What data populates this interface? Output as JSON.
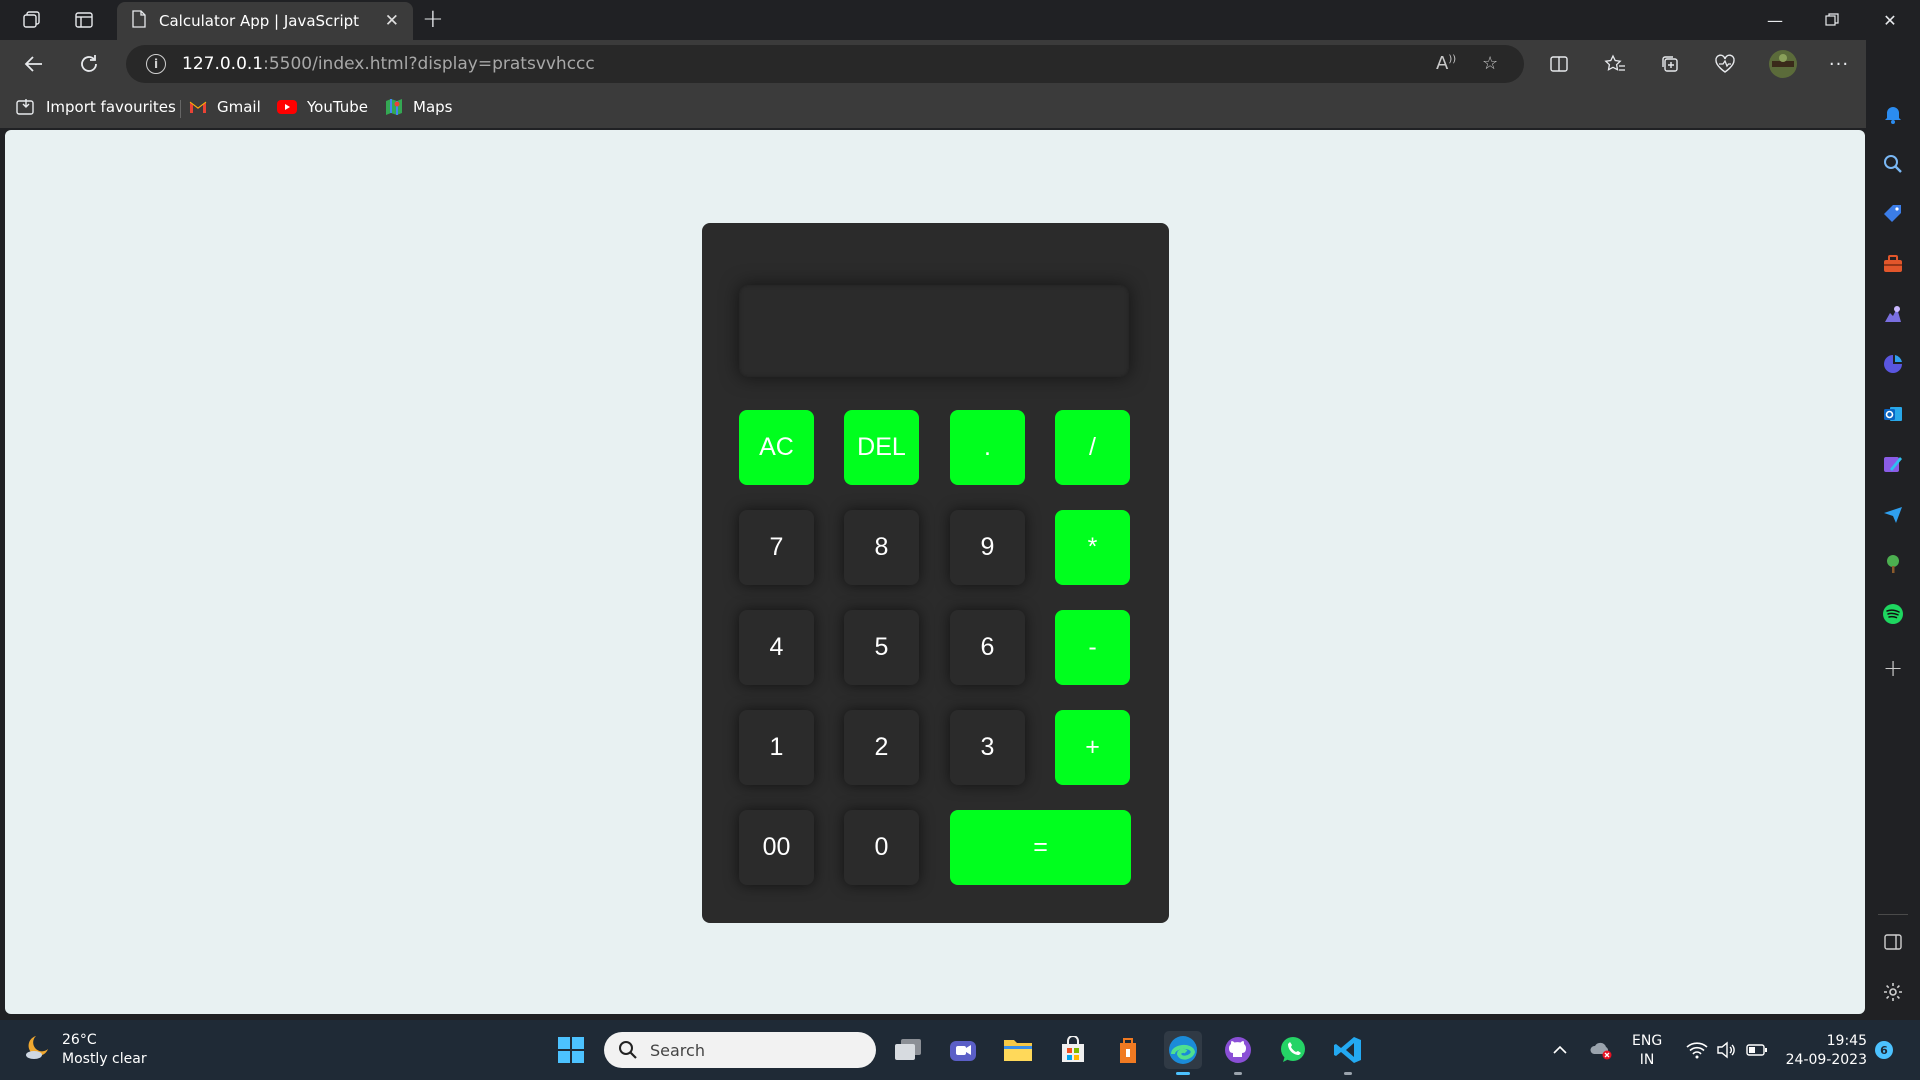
{
  "browser": {
    "tab_title": "Calculator App | JavaScript",
    "url_host": "127.0.0.1",
    "url_rest": ":5500/index.html?display=pratsvvhccc",
    "favourites": [
      "Import favourites",
      "Gmail",
      "YouTube",
      "Maps"
    ]
  },
  "calculator": {
    "display_value": "",
    "keys": {
      "ac": "AC",
      "del": "DEL",
      "dot": ".",
      "divide": "/",
      "seven": "7",
      "eight": "8",
      "nine": "9",
      "multiply": "*",
      "four": "4",
      "five": "5",
      "six": "6",
      "minus": "-",
      "one": "1",
      "two": "2",
      "three": "3",
      "plus": "+",
      "double_zero": "00",
      "zero": "0",
      "equals": "="
    },
    "colors": {
      "operator": "#00ff1e",
      "body": "#2b2b2b",
      "page_bg": "#e8f1f2"
    }
  },
  "taskbar": {
    "temperature": "26°C",
    "weather": "Mostly clear",
    "search_placeholder": "Search",
    "lang_line1": "ENG",
    "lang_line2": "IN",
    "time": "19:45",
    "date": "24-09-2023",
    "notification_count": "6"
  }
}
